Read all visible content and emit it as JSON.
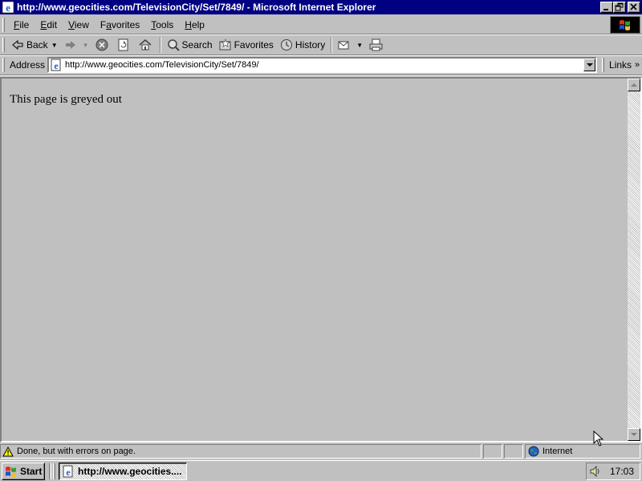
{
  "window": {
    "title": "http://www.geocities.com/TelevisionCity/Set/7849/ - Microsoft Internet Explorer"
  },
  "menu": {
    "items": [
      {
        "pre": "",
        "key": "F",
        "post": "ile"
      },
      {
        "pre": "",
        "key": "E",
        "post": "dit"
      },
      {
        "pre": "",
        "key": "V",
        "post": "iew"
      },
      {
        "pre": "F",
        "key": "a",
        "post": "vorites"
      },
      {
        "pre": "",
        "key": "T",
        "post": "ools"
      },
      {
        "pre": "",
        "key": "H",
        "post": "elp"
      }
    ]
  },
  "toolbar": {
    "back_label": "Back",
    "search_label": "Search",
    "favorites_label": "Favorites",
    "history_label": "History"
  },
  "address": {
    "label": "Address",
    "url": "http://www.geocities.com/TelevisionCity/Set/7849/",
    "links_label": "Links"
  },
  "content": {
    "text": "This page is greyed out"
  },
  "status": {
    "message": "Done, but with errors on page.",
    "zone": "Internet"
  },
  "taskbar": {
    "start_label": "Start",
    "task_label": "http://www.geocities....",
    "clock": "17:03"
  },
  "icons": {
    "title": "ie-icon",
    "status": "warning-icon",
    "zone": "globe-icon",
    "tray": "speaker-icon"
  }
}
